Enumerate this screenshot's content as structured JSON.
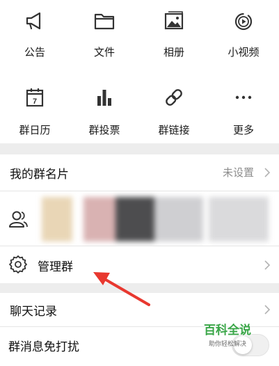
{
  "features": [
    {
      "label": "公告",
      "icon": "megaphone-icon"
    },
    {
      "label": "文件",
      "icon": "folder-icon"
    },
    {
      "label": "相册",
      "icon": "photo-album-icon"
    },
    {
      "label": "小视频",
      "icon": "video-play-icon"
    },
    {
      "label": "群日历",
      "icon": "calendar-icon"
    },
    {
      "label": "群投票",
      "icon": "bar-chart-icon"
    },
    {
      "label": "群链接",
      "icon": "link-icon"
    },
    {
      "label": "更多",
      "icon": "more-dots-icon"
    }
  ],
  "calendar_day": "7",
  "nickname": {
    "label": "我的群名片",
    "value": "未设置"
  },
  "members": {
    "icon": "members-icon"
  },
  "manage": {
    "label": "管理群",
    "icon": "gear-icon"
  },
  "chat_history": {
    "label": "聊天记录"
  },
  "mute": {
    "label": "群消息免打扰"
  },
  "watermark": {
    "title": "百科全说",
    "subtitle": "助你轻松解决"
  },
  "colors": {
    "accent_red": "#e8382f",
    "watermark_green": "#3aa648",
    "icon_dark": "#333333"
  }
}
